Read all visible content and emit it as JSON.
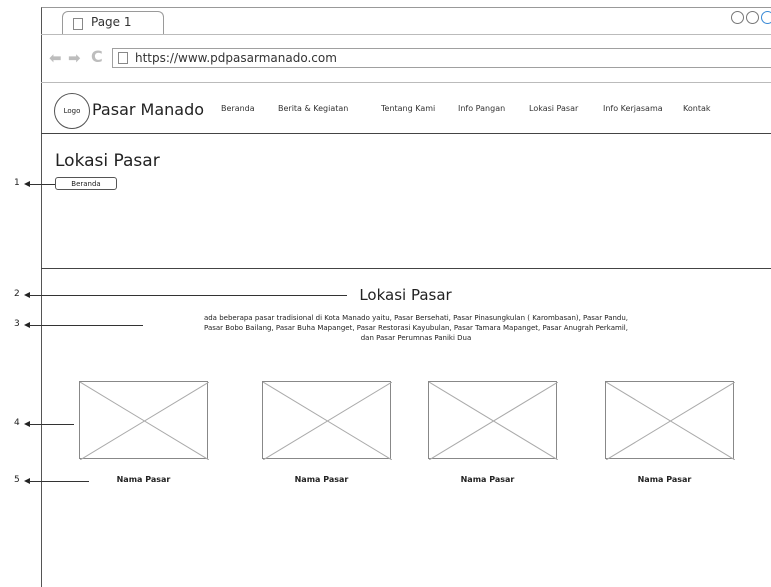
{
  "browser": {
    "tab_title": "Page 1",
    "url": "https://www.pdpasarmanado.com"
  },
  "header": {
    "logo_text": "Logo",
    "brand": "Pasar Manado",
    "menu": [
      "Beranda",
      "Berita & Kegiatan",
      "Tentang Kami",
      "Info Pangan",
      "Lokasi Pasar",
      "Info Kerjasama",
      "Kontak"
    ]
  },
  "hero": {
    "title": "Lokasi Pasar",
    "breadcrumb": "Beranda"
  },
  "section": {
    "title": "Lokasi Pasar",
    "description_lines": [
      "ada beberapa pasar tradisional di Kota Manado yaitu, Pasar Bersehati, Pasar Pinasungkulan ( Karombasan), Pasar Pandu,",
      "Pasar Bobo Bailang, Pasar Buha Mapanget, Pasar Restorasi Kayubulan, Pasar Tamara Mapanget, Pasar Anugrah Perkamil,",
      "dan Pasar Perumnas Paniki Dua"
    ],
    "markets": [
      {
        "name": "Nama Pasar"
      },
      {
        "name": "Nama Pasar"
      },
      {
        "name": "Nama Pasar"
      },
      {
        "name": "Nama Pasar"
      }
    ]
  },
  "annotations": [
    "1",
    "2",
    "3",
    "4",
    "5"
  ]
}
